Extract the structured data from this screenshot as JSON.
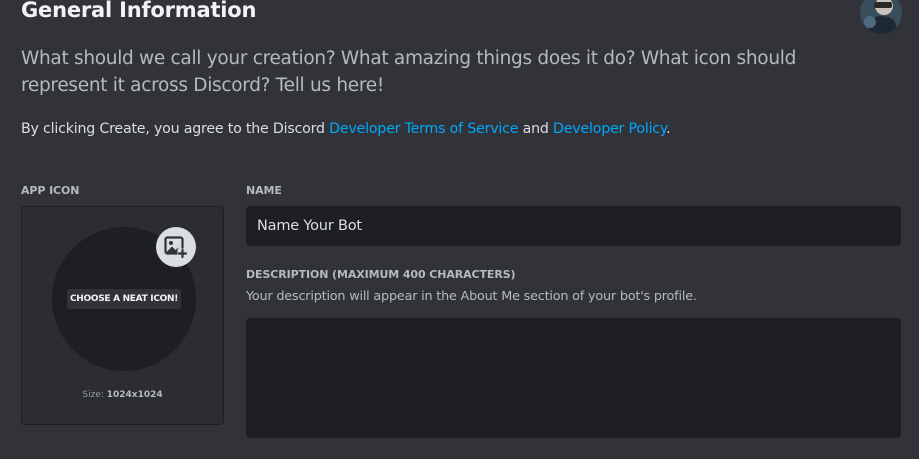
{
  "header": {
    "title": "General Information"
  },
  "intro": {
    "text": "What should we call your creation? What amazing things does it do? What icon should represent it across Discord? Tell us here!"
  },
  "agreement": {
    "prefix": "By clicking Create, you agree to the Discord ",
    "tos_link": "Developer Terms of Service",
    "middle": " and ",
    "policy_link": "Developer Policy",
    "suffix": "."
  },
  "app_icon": {
    "label": "APP ICON",
    "choose_label": "CHOOSE A NEAT ICON!",
    "size_prefix": "Size: ",
    "size_value": "1024x1024",
    "upload_icon": "image-plus-icon"
  },
  "name_field": {
    "label": "NAME",
    "placeholder": "Name Your Bot",
    "value": ""
  },
  "description_field": {
    "label": "DESCRIPTION (MAXIMUM 400 CHARACTERS)",
    "help": "Your description will appear in the About Me section of your bot's profile.",
    "value": ""
  },
  "colors": {
    "background": "#313338",
    "input_bg": "#1e1f22",
    "link": "#00a8fc"
  }
}
